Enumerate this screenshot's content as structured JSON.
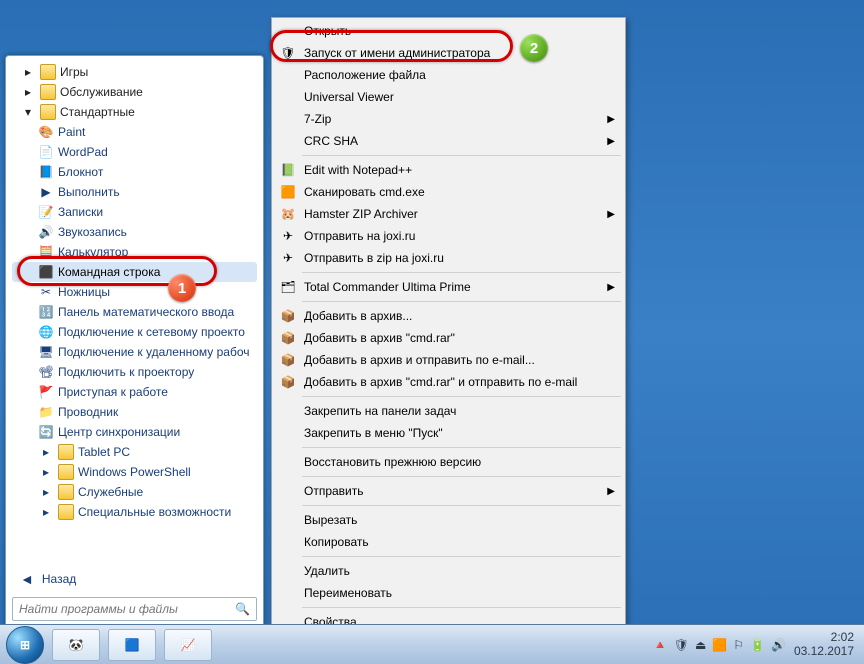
{
  "panel": {
    "folders_top": [
      "Игры",
      "Обслуживание",
      "Стандартные"
    ],
    "items": [
      {
        "icon": "🎨",
        "label": "Paint"
      },
      {
        "icon": "📄",
        "label": "WordPad"
      },
      {
        "icon": "📘",
        "label": "Блокнот"
      },
      {
        "icon": "▶",
        "label": "Выполнить"
      },
      {
        "icon": "📝",
        "label": "Записки"
      },
      {
        "icon": "🔊",
        "label": "Звукозапись"
      },
      {
        "icon": "🧮",
        "label": "Калькулятор"
      },
      {
        "icon": "⬛",
        "label": "Командная строка",
        "sel": true
      },
      {
        "icon": "✂",
        "label": "Ножницы"
      },
      {
        "icon": "🔢",
        "label": "Панель математического ввода"
      },
      {
        "icon": "🌐",
        "label": "Подключение к сетевому проекто"
      },
      {
        "icon": "🖥",
        "label": "Подключение к удаленному рабоч"
      },
      {
        "icon": "📽",
        "label": "Подключить к проектору"
      },
      {
        "icon": "🚩",
        "label": "Приступая к работе"
      },
      {
        "icon": "📁",
        "label": "Проводник"
      },
      {
        "icon": "🔄",
        "label": "Центр синхронизации"
      }
    ],
    "folders_bottom": [
      "Tablet PC",
      "Windows PowerShell",
      "Служебные",
      "Специальные возможности"
    ],
    "back": "Назад",
    "search_placeholder": "Найти программы и файлы"
  },
  "ctx": [
    {
      "t": "item",
      "icon": "",
      "label": "Открыть"
    },
    {
      "t": "item",
      "icon": "🛡",
      "label": "Запуск от имени администратора"
    },
    {
      "t": "item",
      "icon": "",
      "label": "Расположение файла"
    },
    {
      "t": "item",
      "icon": "",
      "label": "Universal Viewer"
    },
    {
      "t": "item",
      "icon": "",
      "label": "7-Zip",
      "sub": true
    },
    {
      "t": "item",
      "icon": "",
      "label": "CRC SHA",
      "sub": true
    },
    {
      "t": "sep"
    },
    {
      "t": "item",
      "icon": "📗",
      "label": "Edit with Notepad++"
    },
    {
      "t": "item",
      "icon": "🟧",
      "label": "Сканировать cmd.exe"
    },
    {
      "t": "item",
      "icon": "🐹",
      "label": "Hamster ZIP Archiver",
      "sub": true
    },
    {
      "t": "item",
      "icon": "✈",
      "label": "Отправить на joxi.ru"
    },
    {
      "t": "item",
      "icon": "✈",
      "label": "Отправить в zip на joxi.ru"
    },
    {
      "t": "sep"
    },
    {
      "t": "item",
      "icon": "🗂",
      "label": "Total Commander Ultima Prime",
      "sub": true
    },
    {
      "t": "sep"
    },
    {
      "t": "item",
      "icon": "📦",
      "label": "Добавить в архив..."
    },
    {
      "t": "item",
      "icon": "📦",
      "label": "Добавить в архив \"cmd.rar\""
    },
    {
      "t": "item",
      "icon": "📦",
      "label": "Добавить в архив и отправить по e-mail..."
    },
    {
      "t": "item",
      "icon": "📦",
      "label": "Добавить в архив \"cmd.rar\" и отправить по e-mail"
    },
    {
      "t": "sep"
    },
    {
      "t": "item",
      "icon": "",
      "label": "Закрепить на панели задач"
    },
    {
      "t": "item",
      "icon": "",
      "label": "Закрепить в меню \"Пуск\""
    },
    {
      "t": "sep"
    },
    {
      "t": "item",
      "icon": "",
      "label": "Восстановить прежнюю версию"
    },
    {
      "t": "sep"
    },
    {
      "t": "item",
      "icon": "",
      "label": "Отправить",
      "sub": true
    },
    {
      "t": "sep"
    },
    {
      "t": "item",
      "icon": "",
      "label": "Вырезать"
    },
    {
      "t": "item",
      "icon": "",
      "label": "Копировать"
    },
    {
      "t": "sep"
    },
    {
      "t": "item",
      "icon": "",
      "label": "Удалить"
    },
    {
      "t": "item",
      "icon": "",
      "label": "Переименовать"
    },
    {
      "t": "sep"
    },
    {
      "t": "item",
      "icon": "",
      "label": "Свойства"
    }
  ],
  "taskbar": {
    "buttons": [
      "🐼",
      "🟦",
      "📈"
    ],
    "tray_icons": [
      "🔺",
      "🛡",
      "⏏",
      "🟧",
      "⚐",
      "🔋",
      "🔊"
    ],
    "time": "2:02",
    "date": "03.12.2017"
  },
  "markers": {
    "m1": "1",
    "m2": "2"
  }
}
